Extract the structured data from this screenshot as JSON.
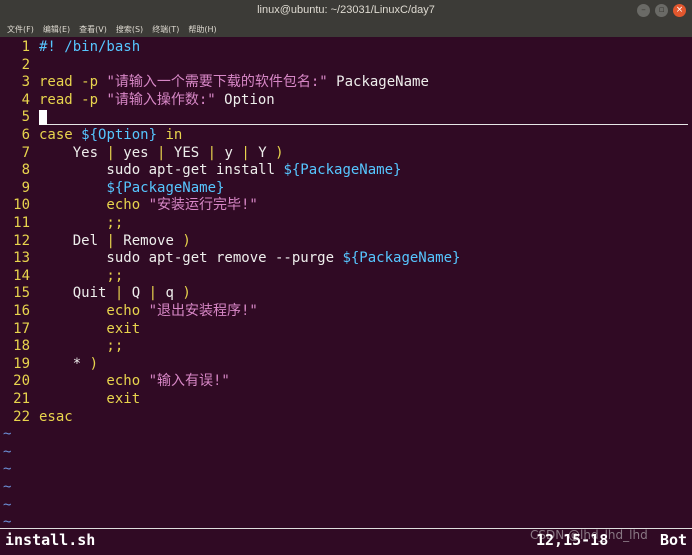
{
  "window": {
    "title": "linux@ubuntu: ~/23031/LinuxC/day7"
  },
  "menu": [
    "文件(F)",
    "编辑(E)",
    "查看(V)",
    "搜索(S)",
    "终端(T)",
    "帮助(H)"
  ],
  "code": [
    {
      "n": "1",
      "segs": [
        {
          "t": "#! /bin/bash",
          "c": "cmt"
        }
      ]
    },
    {
      "n": "2",
      "segs": []
    },
    {
      "n": "3",
      "segs": [
        {
          "t": "read -p ",
          "c": "kw"
        },
        {
          "t": "\"请输入一个需要下载的软件包名:\"",
          "c": "str"
        },
        {
          "t": " PackageName",
          "c": ""
        }
      ]
    },
    {
      "n": "4",
      "segs": [
        {
          "t": "read -p ",
          "c": "kw"
        },
        {
          "t": "\"请输入操作数:\"",
          "c": "str"
        },
        {
          "t": " Option",
          "c": ""
        }
      ]
    },
    {
      "n": "5",
      "segs": [
        {
          "t": "",
          "c": "cursor"
        }
      ]
    },
    {
      "n": "6",
      "segs": [
        {
          "t": "case ",
          "c": "kw"
        },
        {
          "t": "${Option}",
          "c": "var"
        },
        {
          "t": " in",
          "c": "kw"
        }
      ]
    },
    {
      "n": "7",
      "segs": [
        {
          "t": "    Yes ",
          "c": ""
        },
        {
          "t": "|",
          "c": "kw"
        },
        {
          "t": " yes ",
          "c": ""
        },
        {
          "t": "|",
          "c": "kw"
        },
        {
          "t": " YES ",
          "c": ""
        },
        {
          "t": "|",
          "c": "kw"
        },
        {
          "t": " y ",
          "c": ""
        },
        {
          "t": "|",
          "c": "kw"
        },
        {
          "t": " Y ",
          "c": ""
        },
        {
          "t": ")",
          "c": "kw"
        }
      ]
    },
    {
      "n": "8",
      "segs": [
        {
          "t": "        sudo apt-get install ",
          "c": ""
        },
        {
          "t": "${PackageName}",
          "c": "var"
        }
      ]
    },
    {
      "n": "9",
      "segs": [
        {
          "t": "        ",
          "c": ""
        },
        {
          "t": "${PackageName}",
          "c": "var"
        }
      ]
    },
    {
      "n": "10",
      "segs": [
        {
          "t": "        echo ",
          "c": "kw"
        },
        {
          "t": "\"安装运行完毕!\"",
          "c": "str"
        }
      ]
    },
    {
      "n": "11",
      "segs": [
        {
          "t": "        ;;",
          "c": "kw"
        }
      ]
    },
    {
      "n": "12",
      "segs": [
        {
          "t": "    Del ",
          "c": ""
        },
        {
          "t": "|",
          "c": "kw"
        },
        {
          "t": " Remove ",
          "c": ""
        },
        {
          "t": ")",
          "c": "kw"
        }
      ]
    },
    {
      "n": "13",
      "segs": [
        {
          "t": "        sudo apt-get remove --purge ",
          "c": ""
        },
        {
          "t": "${PackageName}",
          "c": "var"
        }
      ]
    },
    {
      "n": "14",
      "segs": [
        {
          "t": "        ;;",
          "c": "kw"
        }
      ]
    },
    {
      "n": "15",
      "segs": [
        {
          "t": "    Quit ",
          "c": ""
        },
        {
          "t": "|",
          "c": "kw"
        },
        {
          "t": " Q ",
          "c": ""
        },
        {
          "t": "|",
          "c": "kw"
        },
        {
          "t": " q ",
          "c": ""
        },
        {
          "t": ")",
          "c": "kw"
        }
      ]
    },
    {
      "n": "16",
      "segs": [
        {
          "t": "        echo ",
          "c": "kw"
        },
        {
          "t": "\"退出安装程序!\"",
          "c": "str"
        }
      ]
    },
    {
      "n": "17",
      "segs": [
        {
          "t": "        exit",
          "c": "kw"
        }
      ]
    },
    {
      "n": "18",
      "segs": [
        {
          "t": "        ;;",
          "c": "kw"
        }
      ]
    },
    {
      "n": "19",
      "segs": [
        {
          "t": "    * ",
          "c": ""
        },
        {
          "t": ")",
          "c": "kw"
        }
      ]
    },
    {
      "n": "20",
      "segs": [
        {
          "t": "        echo ",
          "c": "kw"
        },
        {
          "t": "\"输入有误!\"",
          "c": "str"
        }
      ]
    },
    {
      "n": "21",
      "segs": [
        {
          "t": "        exit",
          "c": "kw"
        }
      ]
    },
    {
      "n": "22",
      "segs": [
        {
          "t": "esac",
          "c": "kw"
        }
      ]
    }
  ],
  "tilde_char": "~",
  "tilde_count": 6,
  "status": {
    "filename": "install.sh",
    "position": "12,15-18",
    "scroll": "Bot",
    "watermark": "CSDN @lhd_lhd_lhd"
  }
}
